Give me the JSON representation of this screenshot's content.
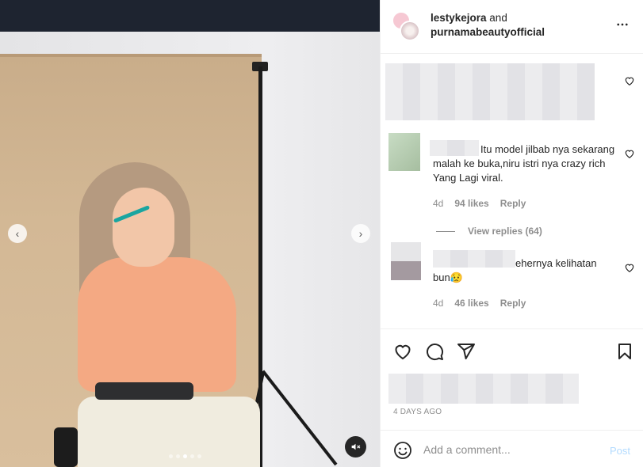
{
  "post": {
    "authors_prefix": "lestykejora",
    "authors_and": " and",
    "authors_second": "purnamabeautyofficial",
    "more_icon": "more-horizontal-icon"
  },
  "media": {
    "prev_icon": "‹",
    "next_icon": "›",
    "slide_count": 5,
    "active_slide": 3,
    "mute_icon": "speaker-muted-icon"
  },
  "comments": [
    {
      "text": "Itu model jilbab nya sekarang malah ke buka,niru istri nya crazy rich Yang Lagi viral.",
      "age": "4d",
      "likes": "94 likes",
      "reply": "Reply",
      "view_replies": "View replies (64)"
    },
    {
      "text": "ehernya kelihatan bun😥",
      "age": "4d",
      "likes": "46 likes",
      "reply": "Reply"
    }
  ],
  "footer": {
    "date": "4 DAYS AGO",
    "comment_placeholder": "Add a comment...",
    "post_label": "Post"
  }
}
